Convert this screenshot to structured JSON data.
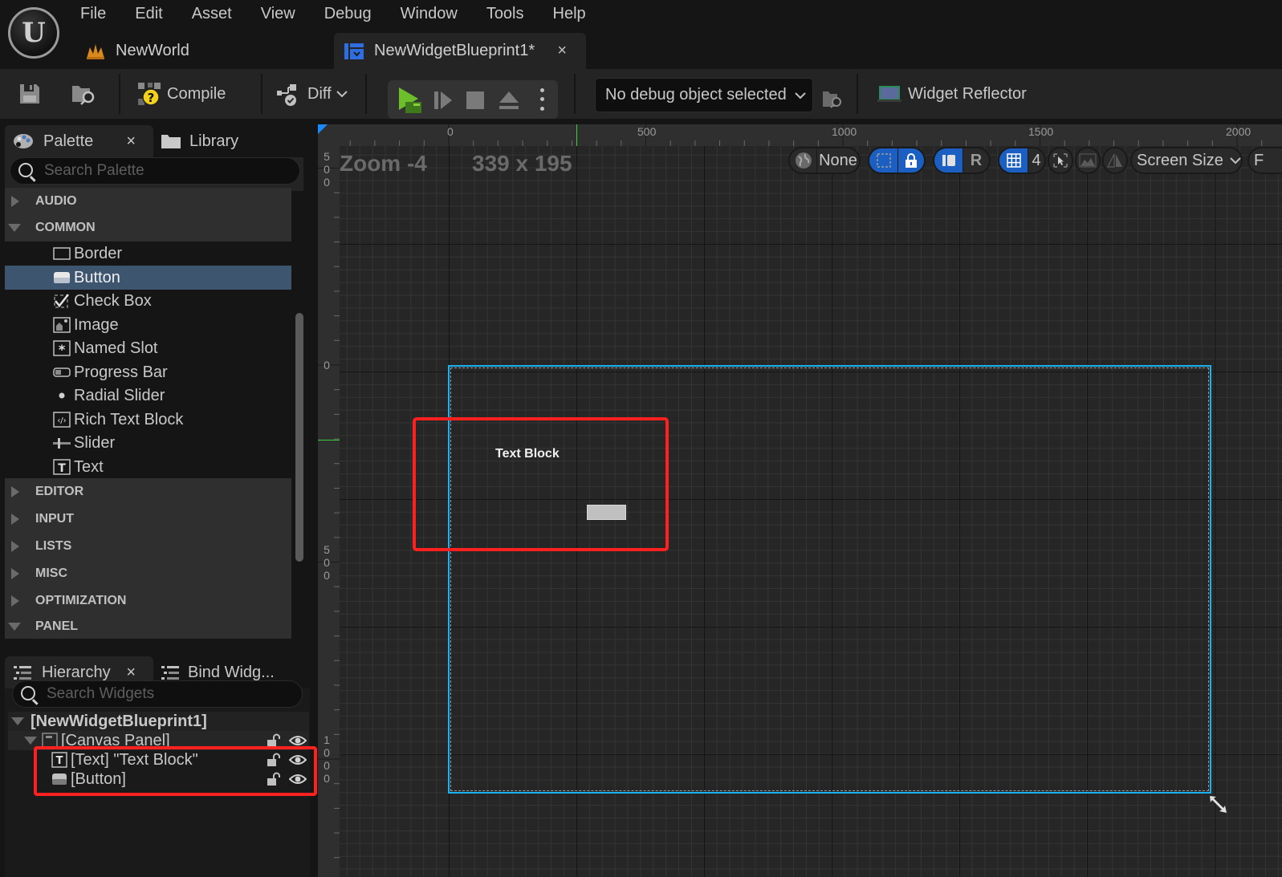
{
  "menubar": [
    "File",
    "Edit",
    "Asset",
    "View",
    "Debug",
    "Window",
    "Tools",
    "Help"
  ],
  "logo_glyph": "U",
  "tabs": {
    "world": {
      "label": "NewWorld"
    },
    "blueprint": {
      "label": "NewWidgetBlueprint1*",
      "close": "×"
    }
  },
  "toolbar": {
    "compile_label": "Compile",
    "diff_label": "Diff",
    "debug_select": "No debug object selected",
    "widget_reflector": "Widget Reflector"
  },
  "palette": {
    "tab_label": "Palette",
    "tab_close": "×",
    "library_label": "Library",
    "search_placeholder": "Search Palette",
    "categories_top": [
      {
        "label": "AUDIO",
        "expanded": false
      },
      {
        "label": "COMMON",
        "expanded": true
      }
    ],
    "common_items": [
      {
        "label": "Border",
        "icon": "border-icon"
      },
      {
        "label": "Button",
        "icon": "button-icon",
        "selected": true
      },
      {
        "label": "Check Box",
        "icon": "checkbox-icon"
      },
      {
        "label": "Image",
        "icon": "image-icon"
      },
      {
        "label": "Named Slot",
        "icon": "named-slot-icon"
      },
      {
        "label": "Progress Bar",
        "icon": "progress-bar-icon"
      },
      {
        "label": "Radial Slider",
        "icon": "radial-slider-icon"
      },
      {
        "label": "Rich Text Block",
        "icon": "rich-text-icon"
      },
      {
        "label": "Slider",
        "icon": "slider-icon"
      },
      {
        "label": "Text",
        "icon": "text-icon"
      }
    ],
    "categories_bottom": [
      {
        "label": "EDITOR",
        "expanded": false
      },
      {
        "label": "INPUT",
        "expanded": false
      },
      {
        "label": "LISTS",
        "expanded": false
      },
      {
        "label": "MISC",
        "expanded": false
      },
      {
        "label": "OPTIMIZATION",
        "expanded": false
      },
      {
        "label": "PANEL",
        "expanded": true
      }
    ]
  },
  "hierarchy": {
    "tab_label": "Hierarchy",
    "tab_close": "×",
    "bind_label": "Bind Widg...",
    "search_placeholder": "Search Widgets",
    "root": "[NewWidgetBlueprint1]",
    "canvas": "[Canvas Panel]",
    "children": [
      {
        "label": "[Text] \"Text Block\"",
        "icon": "text-icon"
      },
      {
        "label": "[Button]",
        "icon": "button-icon"
      }
    ]
  },
  "designer": {
    "zoom_label": "Zoom -4",
    "size_label": "339 x 195",
    "h_ruler": [
      "0",
      "500",
      "1000",
      "1500",
      "2000"
    ],
    "v_ruler": [
      "500",
      "0",
      "500",
      "1000"
    ],
    "toolbar": {
      "localization": "None",
      "r_label": "R",
      "grid_snap": "4",
      "screen_size": "Screen Size",
      "cut_off": "F"
    },
    "canvas_text": "Text Block"
  },
  "colors": {
    "accent_blue": "#1a5fc1",
    "selection_cyan": "#1ab2f0",
    "highlight_red": "#ff2020",
    "selected_row": "#3e5570",
    "play_green": "#6cbf2a"
  }
}
